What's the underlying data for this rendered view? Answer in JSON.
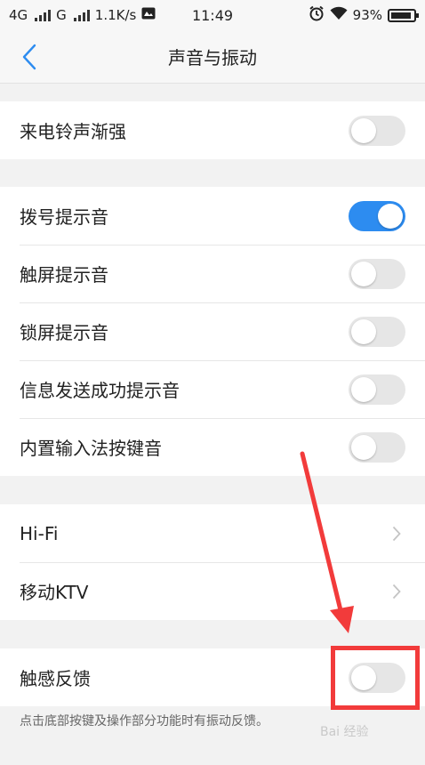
{
  "status_bar": {
    "network1": "4G",
    "network2": "G",
    "speed": "1.1K/s",
    "time": "11:49",
    "battery": "93%"
  },
  "header": {
    "title": "声音与振动",
    "back_icon": "chevron-left-icon"
  },
  "groups": {
    "g1": [
      {
        "label": "来电铃声渐强",
        "state": false
      }
    ],
    "g2": [
      {
        "label": "拨号提示音",
        "state": true
      },
      {
        "label": "触屏提示音",
        "state": false
      },
      {
        "label": "锁屏提示音",
        "state": false
      },
      {
        "label": "信息发送成功提示音",
        "state": false
      },
      {
        "label": "内置输入法按键音",
        "state": false
      }
    ],
    "g3": [
      {
        "label": "Hi-Fi"
      },
      {
        "label": "移动KTV"
      }
    ],
    "g4": [
      {
        "label": "触感反馈",
        "state": false
      }
    ]
  },
  "footnote": "点击底部按键及操作部分功能时有振动反馈。",
  "watermark": "Bai 经验",
  "colors": {
    "accent": "#2d8cf0",
    "annotation": "#f23b3b"
  }
}
